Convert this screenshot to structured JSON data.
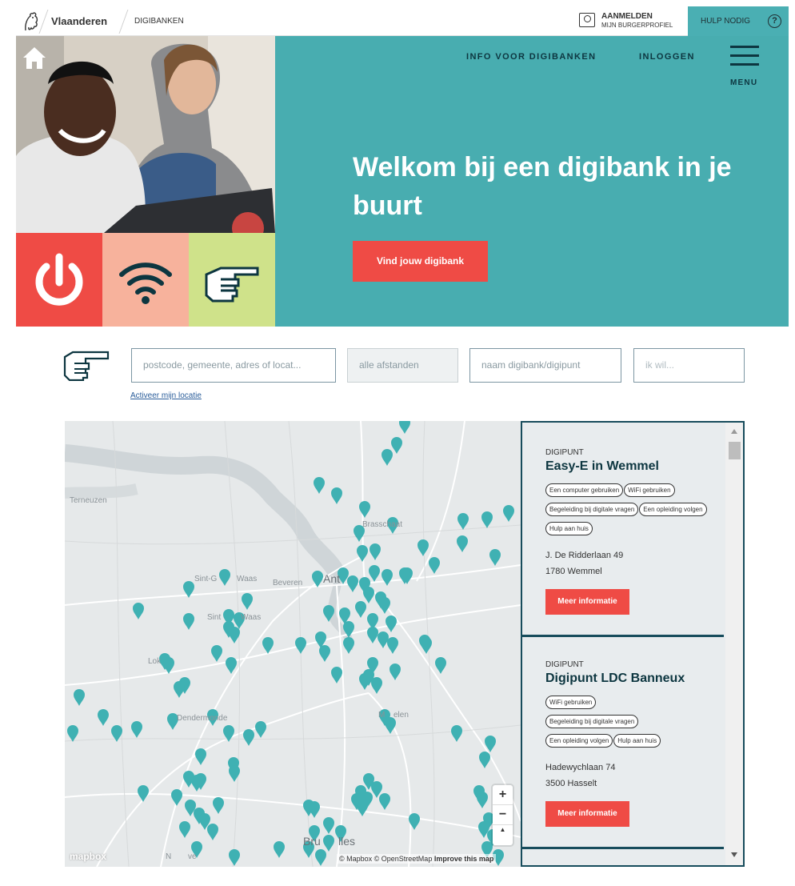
{
  "topbar": {
    "brand": "Vlaanderen",
    "section": "DIGIBANKEN",
    "login_line1": "AANMELDEN",
    "login_line2": "MIJN BURGERPROFIEL",
    "help_label": "HULP NODIG",
    "help_icon": "?"
  },
  "nav": {
    "info_link": "INFO VOOR DIGIBANKEN",
    "login_link": "INLOGGEN",
    "menu_label": "MENU"
  },
  "hero": {
    "title": "Welkom bij een digibank in je buurt",
    "cta": "Vind jouw digibank",
    "tile_colors": [
      "#ef4b45",
      "#f7b29c",
      "#cfe28a"
    ]
  },
  "search": {
    "location_placeholder": "postcode, gemeente, adres of locat...",
    "distance_placeholder": "alle afstanden",
    "name_placeholder": "naam digibank/digipunt",
    "want_placeholder": "ik wil...",
    "geolocate_link": "Activeer mijn locatie"
  },
  "map": {
    "labels": [
      "Terneuzen",
      "Brasschaat",
      "Sint-Gillis-Waas",
      "Beveren",
      "Antwerpen",
      "Sint-Niklaas",
      "Lokeren",
      "Dendermonde",
      "Mechelen",
      "Brussel",
      "Ninove"
    ],
    "visible_labels": [
      "Terneuzen",
      "Brasschaat",
      "Sint-G",
      "Waas",
      "Beveren",
      "Ant",
      "Sint",
      "Waas",
      "Lok",
      "Dendermonde",
      "M",
      "elen",
      "Bru",
      "lles",
      "N",
      "ve"
    ],
    "marker_color": "#3fb1b3",
    "mapbox_label": "mapbox",
    "attribution": "© Mapbox © OpenStreetMap",
    "improve": "Improve this map",
    "zoom_in": "+",
    "zoom_out": "−",
    "compass": "▲"
  },
  "results": [
    {
      "type": "DIGIPUNT",
      "name": "Easy-E in Wemmel",
      "tags": [
        "Een computer gebruiken",
        "WiFi gebruiken",
        "Begeleiding bij digitale vragen",
        "Een opleiding volgen",
        "Hulp aan huis"
      ],
      "street": "J. De Ridderlaan 49",
      "city": "1780 Wemmel",
      "button": "Meer informatie"
    },
    {
      "type": "DIGIPUNT",
      "name": "Digipunt LDC Banneux",
      "tags": [
        "WiFi gebruiken",
        "Begeleiding bij digitale vragen",
        "Een opleiding volgen",
        "Hulp aan huis"
      ],
      "street": "Hadewychlaan 74",
      "city": "3500 Hasselt",
      "button": "Meer informatie"
    }
  ],
  "colors": {
    "teal": "#48adb0",
    "red": "#ef4b45",
    "dark": "#0d3640",
    "panel_border": "#174c5c"
  }
}
